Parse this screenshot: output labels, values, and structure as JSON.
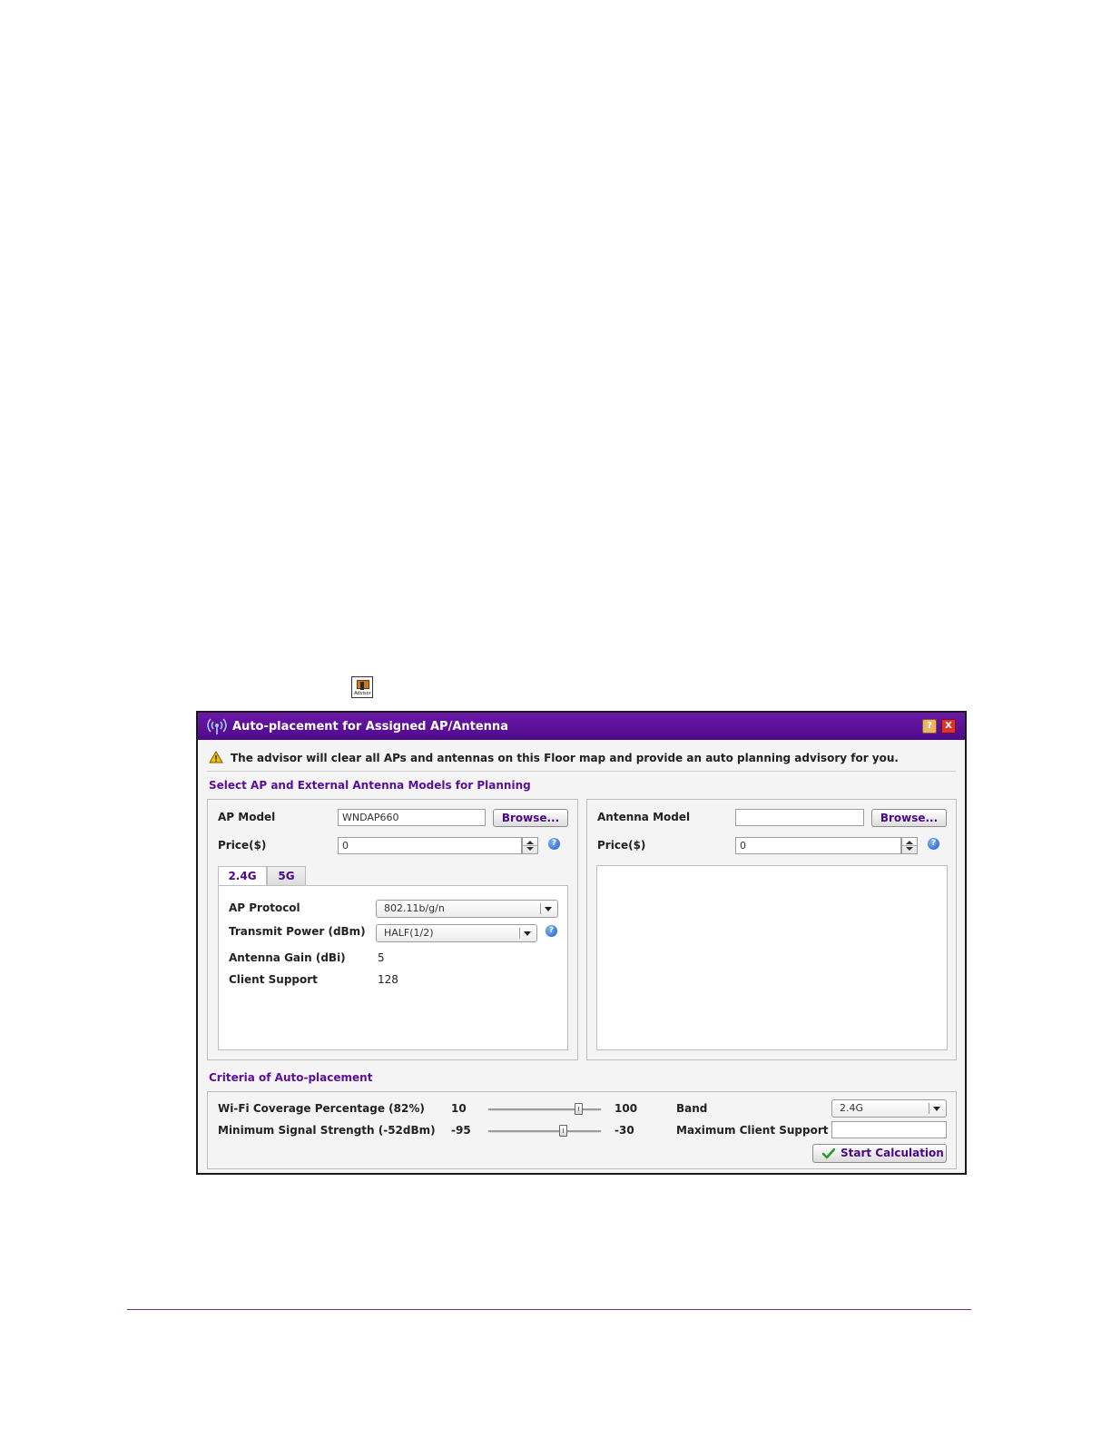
{
  "advisor_icon": {
    "caption": "Advisor"
  },
  "dialog": {
    "title": "Auto-placement for Assigned AP/Antenna",
    "help_glyph": "?",
    "close_glyph": "X",
    "warning": "The advisor will clear all APs and antennas on this Floor map and provide an auto planning advisory for you.",
    "models_section_title": "Select AP and External Antenna Models for Planning",
    "ap": {
      "model_label": "AP Model",
      "model_value": "WNDAP660",
      "browse_label": "Browse...",
      "price_label": "Price($)",
      "price_value": "0",
      "tabs": [
        "2.4G",
        "5G"
      ],
      "active_tab": "2.4G",
      "protocol_label": "AP Protocol",
      "protocol_value": "802.11b/g/n",
      "power_label": "Transmit Power (dBm)",
      "power_value": "HALF(1/2)",
      "gain_label": "Antenna Gain (dBi)",
      "gain_value": "5",
      "client_label": "Client Support",
      "client_value": "128"
    },
    "antenna": {
      "model_label": "Antenna Model",
      "model_value": "",
      "browse_label": "Browse...",
      "price_label": "Price($)",
      "price_value": "0"
    },
    "criteria": {
      "section_title": "Criteria of Auto-placement",
      "coverage_label": "Wi-Fi Coverage Percentage (82%)",
      "coverage_min": "10",
      "coverage_max": "100",
      "coverage_value": 82,
      "signal_label": "Minimum Signal Strength (-52dBm)",
      "signal_min": "-95",
      "signal_max": "-30",
      "signal_value": -52,
      "band_label": "Band",
      "band_value": "2.4G",
      "max_client_label": "Maximum Client Support",
      "max_client_value": "",
      "start_label": "Start Calculation"
    },
    "colors": {
      "title_bar": "#5a0f98",
      "accent_text": "#5a0f98"
    }
  }
}
